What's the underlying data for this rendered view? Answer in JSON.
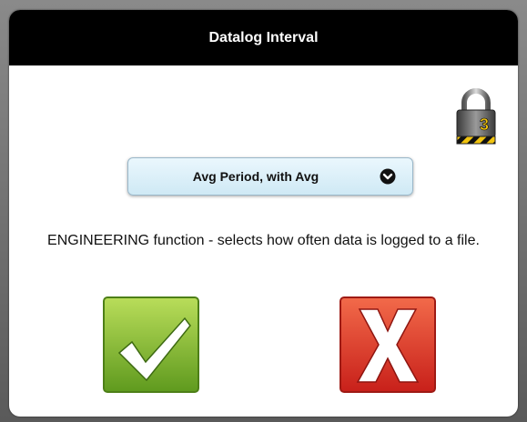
{
  "dialog": {
    "title": "Datalog Interval",
    "lock_level": "3",
    "dropdown": {
      "selected": "Avg Period, with Avg"
    },
    "description": "ENGINEERING function - selects how often data is logged to a file.",
    "buttons": {
      "ok_icon": "checkmark-icon",
      "cancel_icon": "x-icon"
    }
  },
  "colors": {
    "title_bg": "#000000",
    "ok_green": "#7fb62a",
    "cancel_red": "#e0342a",
    "dropdown_bg": "#d6edf8"
  }
}
